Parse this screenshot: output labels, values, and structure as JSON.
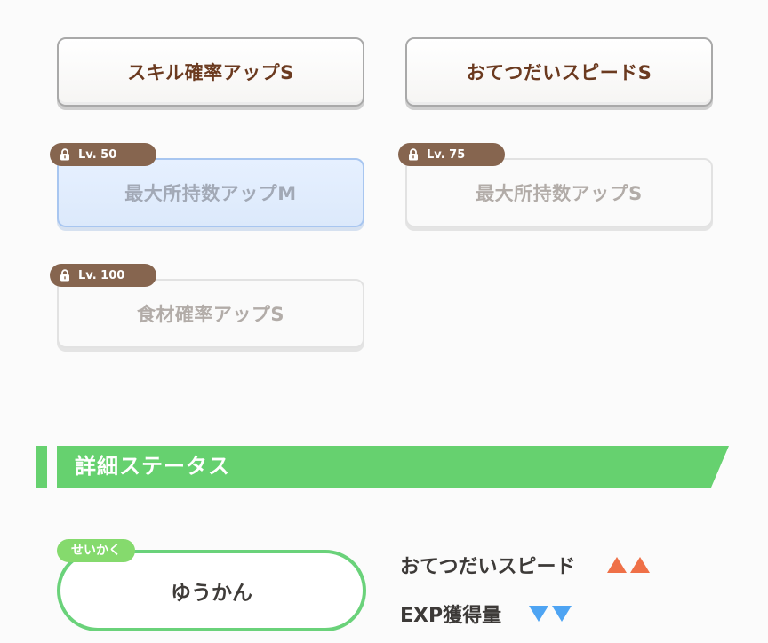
{
  "skills": {
    "s1": {
      "label": "スキル確率アップS"
    },
    "s2": {
      "label": "おてつだいスピードS"
    },
    "s3": {
      "label": "最大所持数アップM",
      "lock": "Lv. 50"
    },
    "s4": {
      "label": "最大所持数アップS",
      "lock": "Lv. 75"
    },
    "s5": {
      "label": "食材確率アップS",
      "lock": "Lv. 100"
    }
  },
  "section": {
    "title": "詳細ステータス"
  },
  "nature": {
    "tag": "せいかく",
    "value": "ゆうかん"
  },
  "stats": [
    {
      "label": "おてつだいスピード",
      "direction": "up",
      "color": "#ef7047"
    },
    {
      "label": "EXP獲得量",
      "direction": "down",
      "color": "#4ea4f3"
    }
  ]
}
